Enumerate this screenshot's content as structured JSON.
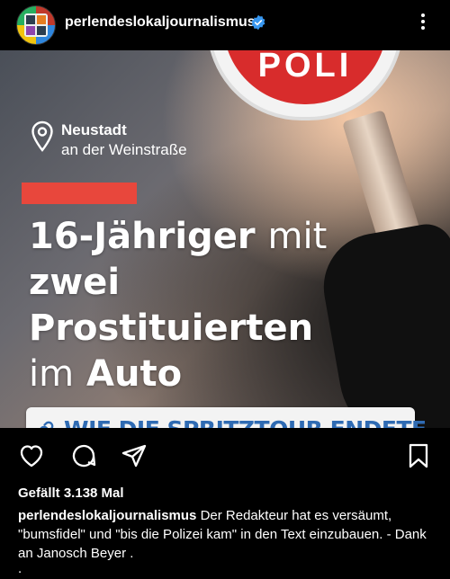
{
  "header": {
    "username": "perlendeslokaljournalismus",
    "verified_icon": "verified-badge-icon",
    "more_icon": "more-options-icon"
  },
  "post": {
    "location_city": "Neustadt",
    "location_sub": "an der Weinstraße",
    "headline_line1_bold": "16-Jähriger",
    "headline_line1_light": "mit",
    "headline_line2": "zwei",
    "headline_line3": "Prostituierten",
    "headline_line4_light": "im",
    "headline_line4_bold": "Auto",
    "paddle_text": "POLI",
    "link_text": "WIE DIE SPRITZTOUR ENDETE"
  },
  "actions": {
    "like_icon": "heart-icon",
    "comment_icon": "comment-icon",
    "share_icon": "send-icon",
    "save_icon": "bookmark-icon"
  },
  "likes_text": "Gefällt 3.138 Mal",
  "caption": {
    "username": "perlendeslokaljournalismus",
    "text": "Der Redakteur hat es versäumt, \"bumsfidel\" und \"bis die Polizei kam\" in den Text einzubauen. - Dank an Janosch Beyer ."
  },
  "tail": ".",
  "colors": {
    "background": "#000000",
    "accent_red": "#e8473c",
    "link_blue": "#2f6bb3",
    "verified_blue": "#3897f0"
  }
}
